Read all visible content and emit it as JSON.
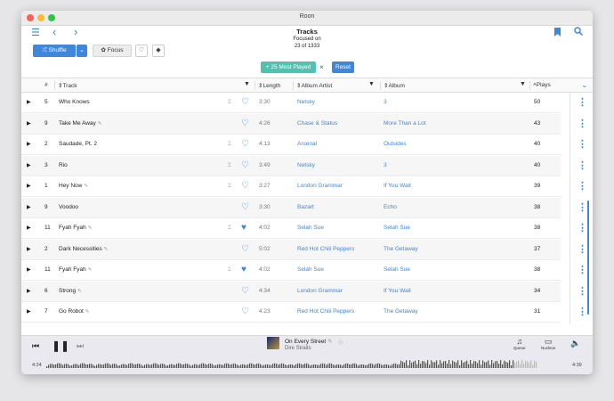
{
  "window": {
    "title": "Roon"
  },
  "header": {
    "title": "Tracks",
    "subtitle": "Focused on",
    "count": "23 of 1333"
  },
  "toolbar": {
    "shuffle": "Shuffle",
    "focus": "Focus"
  },
  "filter": {
    "chip": "25 Most Played",
    "reset": "Reset"
  },
  "columns": {
    "num": "#",
    "track": "Track",
    "length": "Length",
    "album_artist": "Album Artist",
    "album": "Album",
    "plays": "Plays"
  },
  "rows": [
    {
      "num": "5",
      "track": "Who Knows",
      "length": "3:30",
      "artist": "Netsky",
      "album": "3",
      "plays": "50",
      "wave": true,
      "fav": false,
      "edit": false
    },
    {
      "num": "9",
      "track": "Take Me Away",
      "length": "4:26",
      "artist": "Chase & Status",
      "album": "More Than a Lot",
      "plays": "43",
      "wave": false,
      "fav": false,
      "edit": true
    },
    {
      "num": "2",
      "track": "Saudade, Pt. 2",
      "length": "4:13",
      "artist": "Arsenal",
      "album": "Outsides",
      "plays": "40",
      "wave": true,
      "fav": false,
      "edit": false
    },
    {
      "num": "3",
      "track": "Rio",
      "length": "3:49",
      "artist": "Netsky",
      "album": "3",
      "plays": "40",
      "wave": true,
      "fav": false,
      "edit": false
    },
    {
      "num": "1",
      "track": "Hey Now",
      "length": "3:27",
      "artist": "London Grammar",
      "album": "If You Wait",
      "plays": "39",
      "wave": true,
      "fav": false,
      "edit": true
    },
    {
      "num": "9",
      "track": "Voodoo",
      "length": "3:30",
      "artist": "Bazart",
      "album": "Echo",
      "plays": "38",
      "wave": false,
      "fav": false,
      "edit": false
    },
    {
      "num": "11",
      "track": "Fyah Fyah",
      "length": "4:02",
      "artist": "Selah Sue",
      "album": "Selah Sue",
      "plays": "38",
      "wave": true,
      "fav": true,
      "edit": true
    },
    {
      "num": "2",
      "track": "Dark Necessities",
      "length": "5:02",
      "artist": "Red Hot Chili Peppers",
      "album": "The Getaway",
      "plays": "37",
      "wave": false,
      "fav": false,
      "edit": true
    },
    {
      "num": "11",
      "track": "Fyah Fyah",
      "length": "4:02",
      "artist": "Selah Sue",
      "album": "Selah Sue",
      "plays": "38",
      "wave": true,
      "fav": true,
      "edit": true
    },
    {
      "num": "6",
      "track": "Strong",
      "length": "4:34",
      "artist": "London Grammar",
      "album": "If You Wait",
      "plays": "34",
      "wave": false,
      "fav": false,
      "edit": true
    },
    {
      "num": "7",
      "track": "Go Robot",
      "length": "4:23",
      "artist": "Red Hot Chili Peppers",
      "album": "The Getaway",
      "plays": "31",
      "wave": false,
      "fav": false,
      "edit": true
    }
  ],
  "player": {
    "song": "On Every Street",
    "artist": "Dire Straits",
    "queue": "Queue",
    "zone": "Nucleus",
    "elapsed": "4:24",
    "total": "4:39",
    "progress": 0.95
  },
  "colors": {
    "accent": "#3f86dd",
    "chip": "#4fc3b1"
  }
}
